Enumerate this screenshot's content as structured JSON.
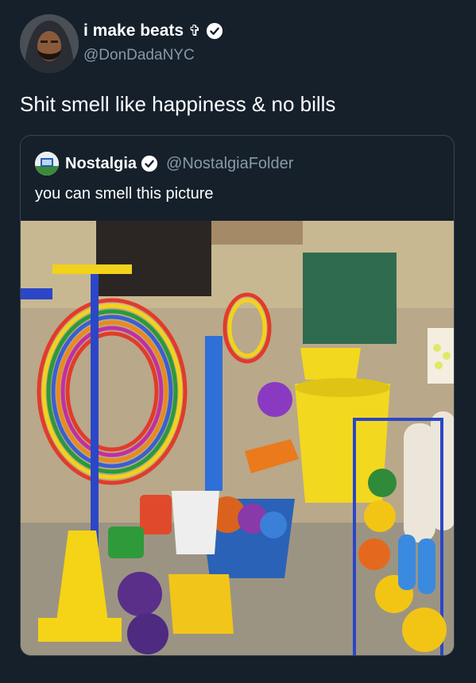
{
  "tweet": {
    "author_name": "i make beats",
    "author_emoji": "✞",
    "author_handle": "@DonDadaNYC",
    "text": "Shit smell like happiness & no bills",
    "verified_icon": "verified-badge-icon"
  },
  "quoted_tweet": {
    "author_name": "Nostalgia",
    "author_handle": "@NostalgiaFolder",
    "text": "you can smell this picture",
    "verified_icon": "verified-badge-icon"
  },
  "colors": {
    "background": "#15202b",
    "border": "#38444d",
    "secondary_text": "#8899a6",
    "primary_text": "#ffffff"
  }
}
